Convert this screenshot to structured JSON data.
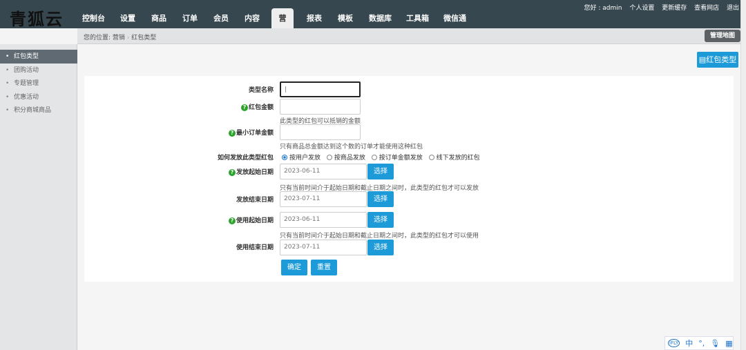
{
  "header": {
    "logo": "青狐云",
    "nav": [
      "控制台",
      "设置",
      "商品",
      "订单",
      "会员",
      "内容",
      "营销",
      "报表",
      "模板",
      "数据库",
      "工具箱",
      "微信通"
    ],
    "active_nav": "营销",
    "top_links": [
      "您好 : admin",
      "个人设置",
      "更新缓存",
      "查看网店",
      "退出"
    ]
  },
  "breadcrumb": {
    "prefix": "您的位置:",
    "items": [
      "营销",
      "红包类型"
    ]
  },
  "map_button": "管理地图",
  "sidebar": {
    "items": [
      "红包类型",
      "团购活动",
      "专题管理",
      "优惠活动",
      "积分商城商品"
    ],
    "active": "红包类型"
  },
  "add_button": "红包类型",
  "form": {
    "type_name": {
      "label": "类型名称",
      "value": ""
    },
    "amount": {
      "label": "红包金额",
      "hint": "此类型的红包可以抵销的金额"
    },
    "min_order": {
      "label": "最小订单金额",
      "hint": "只有商品总金额达到这个数的订单才能使用这种红包"
    },
    "send_type": {
      "label": "如何发放此类型红包",
      "options": [
        "按用户发放",
        "按商品发放",
        "按订单金额发放",
        "线下发放的红包"
      ],
      "selected": "按用户发放"
    },
    "send_start": {
      "label": "发放起始日期",
      "value": "2023-06-11",
      "hint": "只有当前时间介于起始日期和截止日期之间时，此类型的红包才可以发放"
    },
    "send_end": {
      "label": "发放结束日期",
      "value": "2023-07-11"
    },
    "use_start": {
      "label": "使用起始日期",
      "value": "2023-06-11",
      "hint": "只有当前时间介于起始日期和截止日期之间时，此类型的红包才可以使用"
    },
    "use_end": {
      "label": "使用结束日期",
      "value": "2023-07-11"
    },
    "select_label": "选择",
    "submit": "确定",
    "reset": "重置"
  },
  "ime": {
    "lang": "中"
  },
  "colors": {
    "header": "#36474f",
    "accent": "#1d9bd9",
    "help": "#2aa52a"
  }
}
